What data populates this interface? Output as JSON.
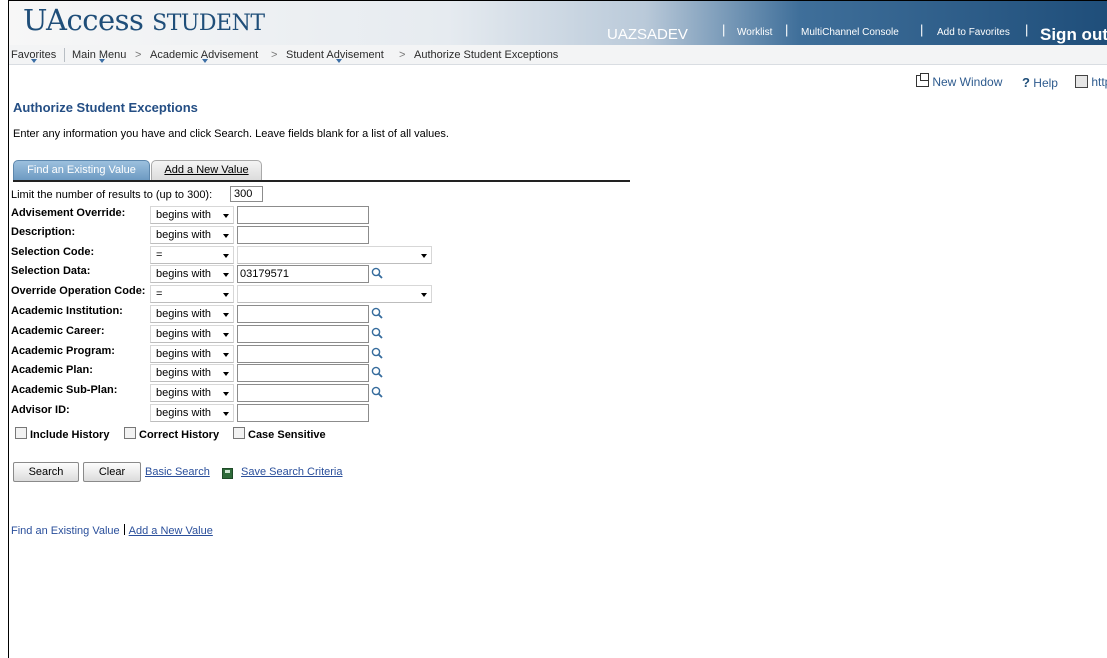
{
  "app": {
    "logo_main": "UAccess",
    "logo_second": "STUDENT",
    "environment": "UAZSADEV"
  },
  "header_links": [
    "Worklist",
    "MultiChannel Console",
    "Add to Favorites"
  ],
  "sign_out": "Sign out",
  "breadcrumb": [
    "Favorites",
    "Main Menu",
    ">",
    "Academic Advisement",
    ">",
    "Student Advisement",
    ">",
    "Authorize Student Exceptions"
  ],
  "page_links": {
    "new_window": "New Window",
    "help_q": "?",
    "help": "Help",
    "http": "http"
  },
  "page": {
    "title": "Authorize Student Exceptions",
    "instructions": "Enter any information you have and click Search. Leave fields blank for a list of all values."
  },
  "tabs": {
    "find": "Find an Existing Value",
    "add": "Add a New Value"
  },
  "limit": {
    "label": "Limit the number of results to (up to 300):",
    "value": "300"
  },
  "fields": [
    {
      "label": "Advisement Override:",
      "operator": "begins with",
      "value": ""
    },
    {
      "label": "Description:",
      "operator": "begins with",
      "value": ""
    },
    {
      "label": "Selection Code:",
      "operator": "=",
      "value": ""
    },
    {
      "label": "Selection Data:",
      "operator": "begins with",
      "value": "03179571"
    },
    {
      "label": "Override Operation Code:",
      "operator": "=",
      "value": ""
    },
    {
      "label": "Academic Institution:",
      "operator": "begins with",
      "value": ""
    },
    {
      "label": "Academic Career:",
      "operator": "begins with",
      "value": ""
    },
    {
      "label": "Academic Program:",
      "operator": "begins with",
      "value": ""
    },
    {
      "label": "Academic Plan:",
      "operator": "begins with",
      "value": ""
    },
    {
      "label": "Academic Sub-Plan:",
      "operator": "begins with",
      "value": ""
    },
    {
      "label": "Advisor ID:",
      "operator": "begins with",
      "value": ""
    }
  ],
  "checkboxes": [
    "Include History",
    "Correct History",
    "Case Sensitive"
  ],
  "buttons": {
    "search": "Search",
    "clear": "Clear"
  },
  "links": {
    "basic_search": "Basic Search",
    "save_criteria": "Save Search Criteria"
  },
  "footer": {
    "find": "Find an Existing Value",
    "add": "Add a New Value"
  },
  "colors": {
    "title": "#244e84",
    "link": "#2a4f9b",
    "header_dark": "#1f4e7a",
    "tab_active": "#6d9ac2"
  }
}
